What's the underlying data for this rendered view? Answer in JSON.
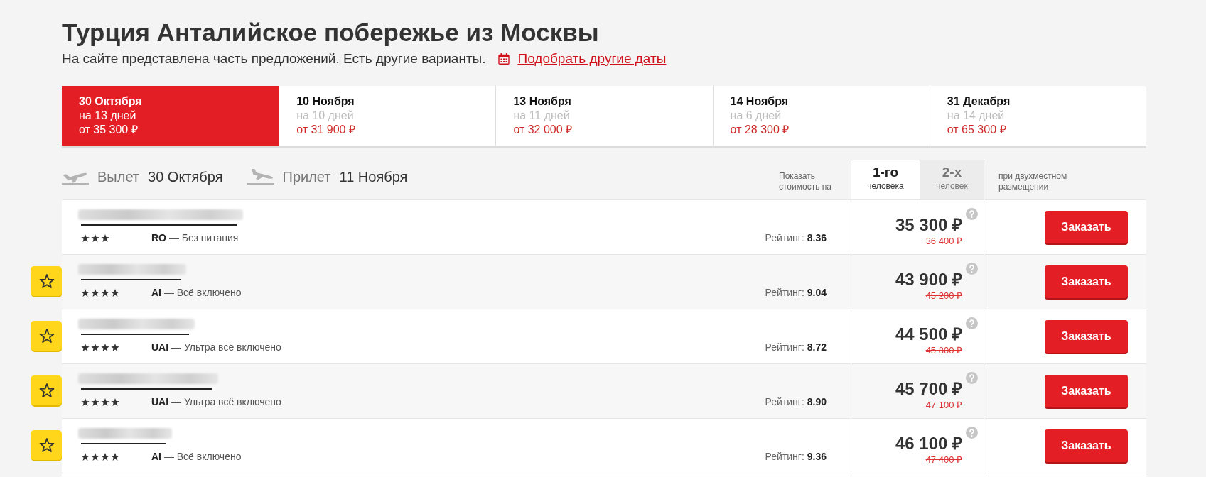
{
  "header": {
    "title": "Турция Анталийское побережье из Москвы",
    "subtitle": "На сайте представлена часть предложений. Есть другие варианты.",
    "dates_link": "Подобрать другие даты"
  },
  "date_tabs": [
    {
      "date": "30 Октября",
      "duration": "на 13 дней",
      "price": "от 35 300 ₽",
      "selected": true
    },
    {
      "date": "10 Ноября",
      "duration": "на 10 дней",
      "price": "от 31 900 ₽",
      "selected": false
    },
    {
      "date": "13 Ноября",
      "duration": "на 11 дней",
      "price": "от 32 000 ₽",
      "selected": false
    },
    {
      "date": "14 Ноября",
      "duration": "на 6 дней",
      "price": "от 28 300 ₽",
      "selected": false
    },
    {
      "date": "31 Декабря",
      "duration": "на 14 дней",
      "price": "от 65 300 ₽",
      "selected": false
    }
  ],
  "flight": {
    "departure_label": "Вылет",
    "departure_date": "30 Октября",
    "arrival_label": "Прилет",
    "arrival_date": "11 Ноября"
  },
  "price_toggle": {
    "label": "Показать стоимость на",
    "options": [
      {
        "count": "1-го",
        "unit": "человека",
        "selected": true
      },
      {
        "count": "2-х",
        "unit": "человек",
        "selected": false
      }
    ],
    "note": "при двухместном размещении"
  },
  "hotels": [
    {
      "featured": false,
      "stars": 3,
      "meal": "**RO** — Без питания",
      "rating": "Рейтинг: **8.36**",
      "price": "35 300 ₽",
      "old_price": "36 400 ₽",
      "button": "Заказать"
    },
    {
      "featured": true,
      "stars": 4,
      "meal": "**AI** — Всё включено",
      "rating": "Рейтинг: **9.04**",
      "price": "43 900 ₽",
      "old_price": "45 200 ₽",
      "button": "Заказать"
    },
    {
      "featured": true,
      "stars": 4,
      "meal": "**UAI** — Ультра всё включено",
      "rating": "Рейтинг: **8.72**",
      "price": "44 500 ₽",
      "old_price": "45 800 ₽",
      "button": "Заказать"
    },
    {
      "featured": true,
      "stars": 4,
      "meal": "**UAI** — Ультра всё включено",
      "rating": "Рейтинг: **8.90**",
      "price": "45 700 ₽",
      "old_price": "47 100 ₽",
      "button": "Заказать"
    },
    {
      "featured": true,
      "stars": 4,
      "meal": "**AI** — Всё включено",
      "rating": "Рейтинг: **9.36**",
      "price": "46 100 ₽",
      "old_price": "47 400 ₽",
      "button": "Заказать"
    }
  ]
}
